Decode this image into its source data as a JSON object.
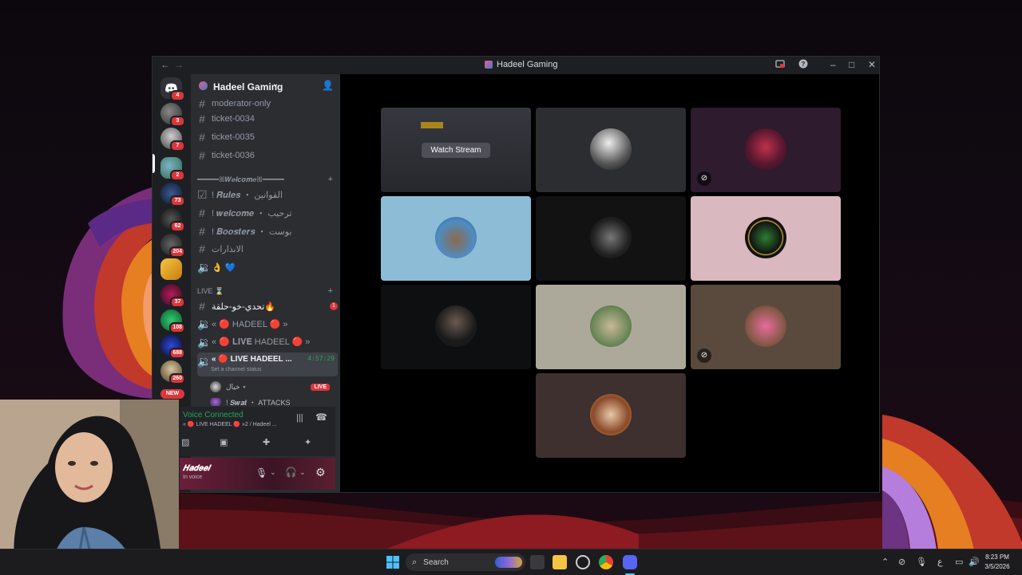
{
  "window": {
    "title": "Hadeel Gaming"
  },
  "server": {
    "name": "Hadeel Gaming"
  },
  "rail": {
    "badges": [
      "4",
      "3",
      "7",
      "2",
      "73",
      "62",
      "204",
      "37",
      "108",
      "688",
      "260"
    ],
    "new_label": "NEW"
  },
  "channels": {
    "top": [
      "moderator-only",
      "ticket-0034",
      "ticket-0035",
      "ticket-0036"
    ],
    "welcome_category": "━━━━━ꕤ𝑾𝒆𝒍𝒄𝒐𝒎𝒆ꕤ━━━━━",
    "welcome_items": [
      {
        "label": "! 𝑹𝒖𝒍𝒆𝒔 ・ القوانين"
      },
      {
        "label": "! 𝒘𝒆𝒍𝒄𝒐𝒎𝒆 ・ ترحيب"
      },
      {
        "label": "! 𝑩𝒐𝒐𝒔𝒕𝒆𝒓𝒔 ・ بوست"
      },
      {
        "label": "الانذارات"
      },
      {
        "label": "👌 💙"
      }
    ],
    "live_category": "LIVE ⌛",
    "live_items": [
      {
        "label": "تحدي-خو-حلقة🔥",
        "badge": "1"
      },
      {
        "label": "« 🔴 HADEEL 🔴 »"
      },
      {
        "label": "« 🔴 𝐋𝐈𝐕𝐄 HADEEL 🔴 »"
      }
    ],
    "active": {
      "label": "« 🔴 LIVE HADEEL ...",
      "timer": "4:57:29",
      "status": "Set a channel status"
    },
    "voice_users": [
      {
        "name": "خيال ⋆",
        "tag": "LIVE"
      },
      {
        "name": "! 𝑺𝒘𝒂𝒕 ・ ATTACKS"
      }
    ]
  },
  "voice": {
    "status": "Voice Connected",
    "channel": "« 🔴 LIVE HADEEL 🔴 »2 / Hadeel ..."
  },
  "user": {
    "name": "𝑯𝒂𝒅𝒆𝒆𝒍",
    "status": "In voice"
  },
  "stage": {
    "watch_label": "Watch Stream"
  },
  "taskbar": {
    "search": "Search",
    "lang": "ع",
    "time": "8:23 PM",
    "date": "3/5/2026"
  },
  "colors": {
    "accent": "#23a55a",
    "danger": "#da373c",
    "live": "#da373c"
  },
  "icons": [
    "discord-icon",
    "search-icon",
    "hash-icon",
    "speaker-icon",
    "mic-icon",
    "headphones-icon",
    "gear-icon",
    "windows-start-icon"
  ]
}
